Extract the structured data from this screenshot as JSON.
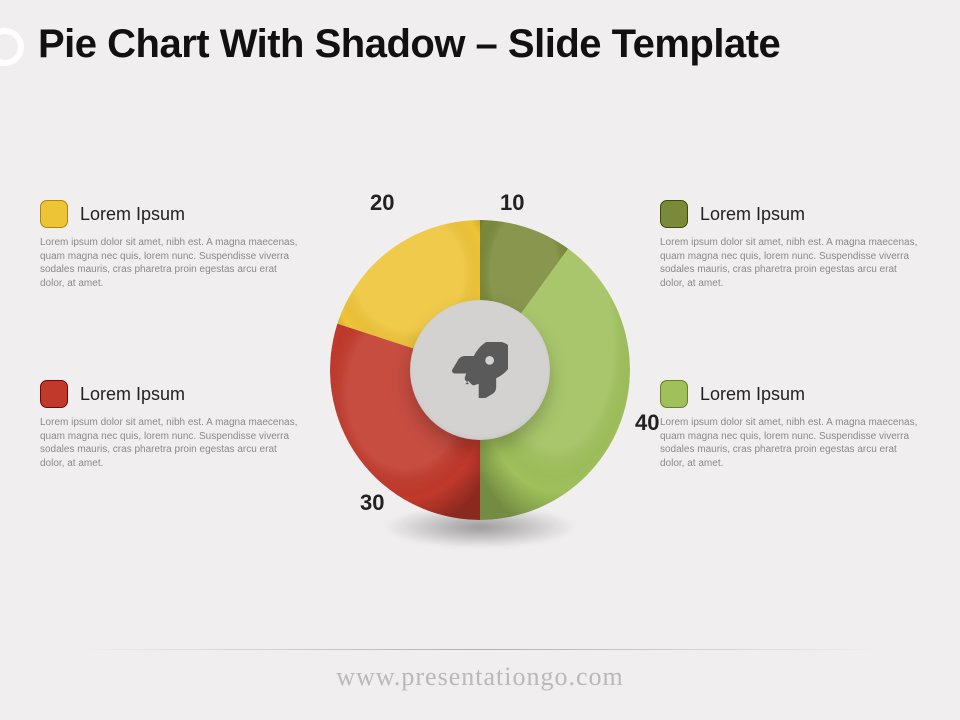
{
  "title": "Pie Chart With Shadow – Slide Template",
  "footer": "www.presentationgo.com",
  "chart_data": {
    "type": "pie",
    "title": "Pie Chart With Shadow",
    "series": [
      {
        "name": "Lorem Ipsum",
        "value": 10,
        "color": "#7a8a3a"
      },
      {
        "name": "Lorem Ipsum",
        "value": 40,
        "color": "#9fc05b"
      },
      {
        "name": "Lorem Ipsum",
        "value": 30,
        "color": "#c1392b"
      },
      {
        "name": "Lorem Ipsum",
        "value": 20,
        "color": "#eec437"
      }
    ],
    "center_icon": "rocket"
  },
  "legend": {
    "tl": {
      "title": "Lorem Ipsum",
      "body": "Lorem ipsum dolor sit amet, nibh est. A magna maecenas, quam magna nec quis, lorem nunc. Suspendisse viverra sodales mauris, cras pharetra proin egestas arcu erat dolor, at amet.",
      "color": "#eec437"
    },
    "bl": {
      "title": "Lorem Ipsum",
      "body": "Lorem ipsum dolor sit amet, nibh est. A magna maecenas, quam magna nec quis, lorem nunc. Suspendisse viverra sodales mauris, cras pharetra proin egestas arcu erat dolor, at amet.",
      "color": "#c1392b"
    },
    "tr": {
      "title": "Lorem Ipsum",
      "body": "Lorem ipsum dolor sit amet, nibh est. A magna maecenas, quam magna nec quis, lorem nunc. Suspendisse viverra sodales mauris, cras pharetra proin egestas arcu erat dolor, at amet.",
      "color": "#7a8a3a"
    },
    "br": {
      "title": "Lorem Ipsum",
      "body": "Lorem ipsum dolor sit amet, nibh est. A magna maecenas, quam magna nec quis, lorem nunc. Suspendisse viverra sodales mauris, cras pharetra proin egestas arcu erat dolor, at amet.",
      "color": "#9fc05b"
    }
  },
  "labels": {
    "v10": "10",
    "v20": "20",
    "v30": "30",
    "v40": "40"
  }
}
